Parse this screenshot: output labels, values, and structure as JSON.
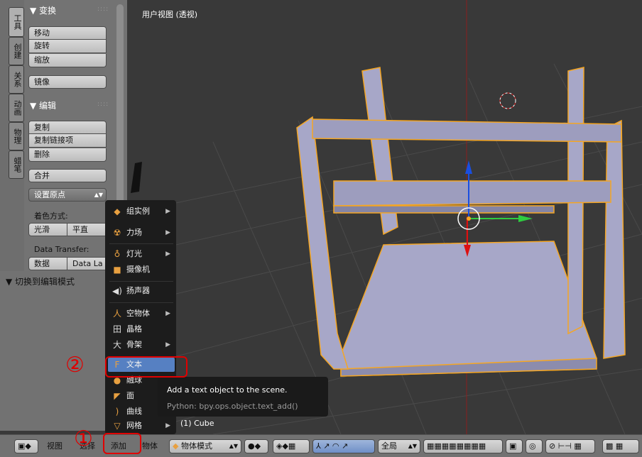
{
  "tool_tabs": [
    {
      "label": "工具",
      "active": true
    },
    {
      "label": "创建",
      "active": false
    },
    {
      "label": "关系",
      "active": false
    },
    {
      "label": "动画",
      "active": false
    },
    {
      "label": "物理",
      "active": false
    },
    {
      "label": "蜡笔",
      "active": false
    }
  ],
  "transform_panel": {
    "title": "▼ 变换",
    "buttons": [
      "移动",
      "旋转",
      "缩放",
      "镜像"
    ]
  },
  "edit_panel": {
    "title": "▼ 编辑",
    "buttons": [
      "复制",
      "复制链接项",
      "删除",
      "合并"
    ],
    "origin_select": "设置原点",
    "shading_label": "着色方式:",
    "shading_smooth": "光滑",
    "shading_flat": "平直",
    "data_transfer_label": "Data Transfer:",
    "data_btn": "数据",
    "data_layout_btn": "Data La"
  },
  "redo_panel": {
    "title": "▼ 切换到编辑模式"
  },
  "viewport": {
    "title": "用户视图 (透视)",
    "status": "(1) Cube"
  },
  "add_menu": {
    "items": [
      {
        "label": "组实例",
        "submenu": true
      },
      {
        "label": "力场",
        "submenu": true
      },
      {
        "label": "灯光",
        "submenu": true
      },
      {
        "label": "摄像机",
        "submenu": false
      },
      {
        "label": "扬声器",
        "submenu": false
      },
      {
        "label": "空物体",
        "submenu": true
      },
      {
        "label": "晶格",
        "submenu": false
      },
      {
        "label": "骨架",
        "submenu": true
      },
      {
        "label": "文本",
        "submenu": false,
        "highlighted": true
      },
      {
        "label": "融球",
        "submenu": false
      },
      {
        "label": "面",
        "submenu": false
      },
      {
        "label": "曲线",
        "submenu": false
      },
      {
        "label": "网格",
        "submenu": true
      }
    ]
  },
  "tooltip": {
    "title": "Add a text object to the scene.",
    "python": "Python: bpy.ops.object.text_add()"
  },
  "header": {
    "view": "视图",
    "select": "选择",
    "add": "添加",
    "object": "物体",
    "mode": "物体模式",
    "pivot_scope": "全局"
  },
  "annotations": {
    "step1": "①",
    "step2": "②",
    "color": "#e00000"
  },
  "colors": {
    "selection_outline": "#f5a623",
    "axis_x": "#2ecc40",
    "axis_y": "#d11",
    "axis_z": "#1a4fe0",
    "menu_highlight": "#5680c2"
  }
}
